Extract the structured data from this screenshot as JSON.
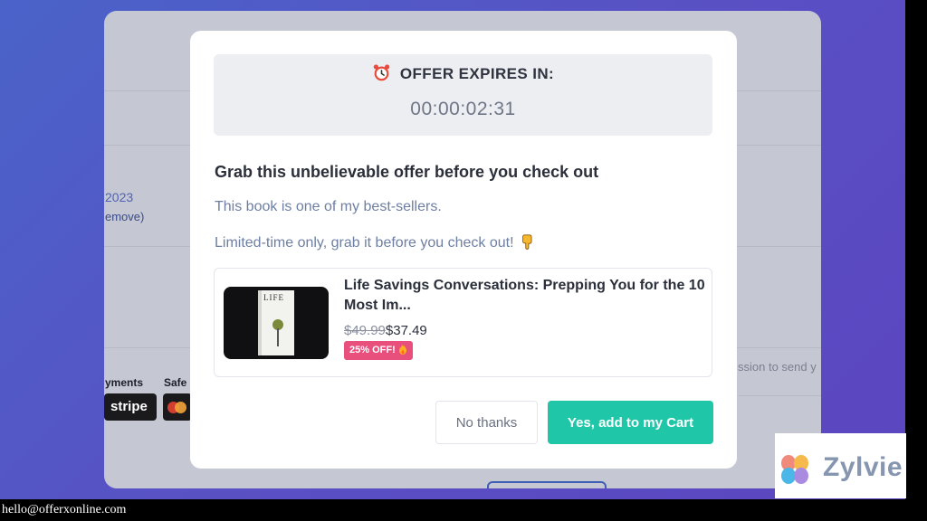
{
  "background": {
    "date_text": "2023",
    "remove_text": "emove)",
    "payments_label": "yments",
    "safe_label": "Safe",
    "stripe_label": "stripe",
    "permission_text": "ssion to send y"
  },
  "modal": {
    "timer": {
      "label": "OFFER EXPIRES IN:",
      "value": "00:00:02:31",
      "icon": "alarm-clock-icon"
    },
    "heading": "Grab this unbelievable offer before you check out",
    "description_1": "This book is one of my best-sellers.",
    "description_2": "Limited-time only, grab it before you check out!",
    "description_2_icon": "pointing-down-hand-icon",
    "product": {
      "title": "Life Savings Conversations: Prepping You for the 10 Most Im...",
      "original_price": "$49.99",
      "sale_price": "$37.49",
      "discount_badge": "25% OFF!",
      "badge_icon": "fire-icon"
    },
    "buttons": {
      "decline": "No thanks",
      "accept": "Yes, add to my Cart"
    }
  },
  "watermark": {
    "logo_text": "Zylvie"
  },
  "footer": {
    "email": "hello@offerxonline.com"
  },
  "colors": {
    "accent": "#1fc7a8",
    "badge": "#e84f7d",
    "background_gradient_start": "#4a63c9",
    "background_gradient_end": "#5b46c0"
  }
}
